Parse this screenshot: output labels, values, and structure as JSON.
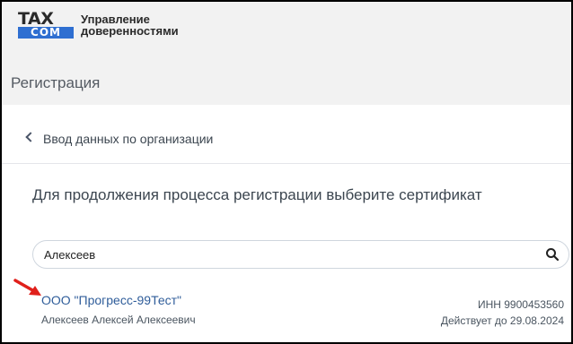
{
  "header": {
    "logo_top": "TAX",
    "logo_bottom": "COM",
    "service_line1": "Управление",
    "service_line2": "доверенностями",
    "page_title": "Регистрация"
  },
  "back": {
    "label": "Ввод данных по организации"
  },
  "main": {
    "heading": "Для продолжения процесса регистрации выберите сертификат",
    "search": {
      "value": "Алексеев"
    }
  },
  "results": [
    {
      "org": "ООО \"Прогресс-99Тест\"",
      "person": "Алексеев Алексей Алексеевич",
      "inn": "ИНН 9900453560",
      "valid_until": "Действует до 29.08.2024"
    }
  ],
  "colors": {
    "accent": "#2f6fd1",
    "link": "#2f5d9a",
    "annotation_arrow": "#e0201b"
  }
}
